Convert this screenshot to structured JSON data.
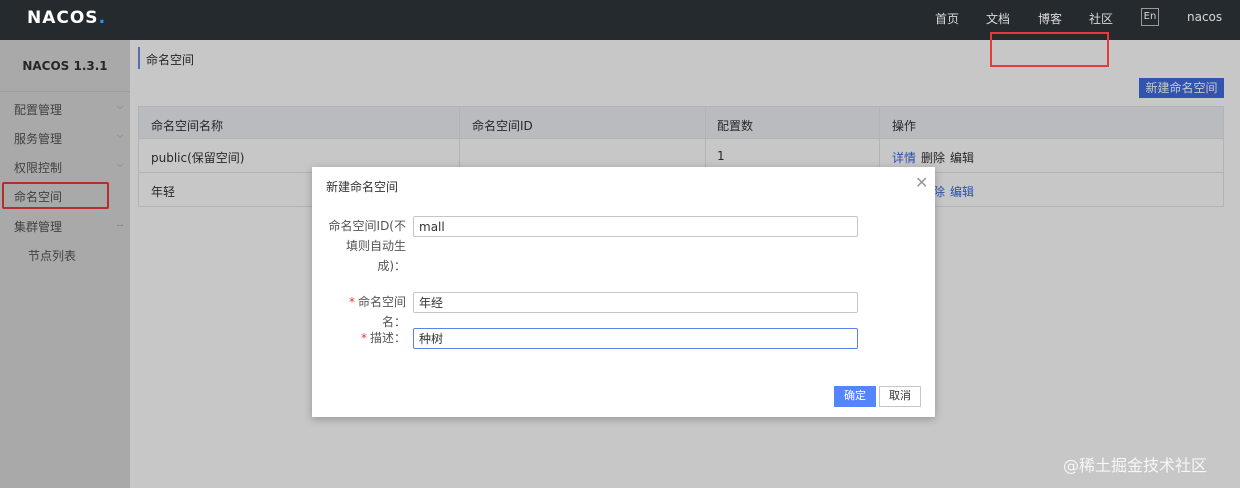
{
  "header": {
    "logo_text": "NACOS",
    "logo_dot": ".",
    "nav": [
      "首页",
      "文档",
      "博客",
      "社区"
    ],
    "lang": "En",
    "user": "nacos"
  },
  "sidebar": {
    "version": "NACOS 1.3.1",
    "items": [
      "配置管理",
      "服务管理",
      "权限控制",
      "命名空间",
      "集群管理"
    ],
    "sub_items": [
      "节点列表"
    ]
  },
  "main": {
    "breadcrumb": "命名空间",
    "new_button": "新建命名空间",
    "table": {
      "headers": [
        "命名空间名称",
        "命名空间ID",
        "配置数",
        "操作"
      ],
      "rows": [
        {
          "name": "public(保留空间)",
          "id": "",
          "count": "1",
          "ops": [
            "详情",
            "删除",
            "编辑"
          ]
        },
        {
          "name": "年轻",
          "id": "",
          "count": "",
          "ops": [
            "除",
            "编辑"
          ]
        }
      ]
    }
  },
  "dialog": {
    "title": "新建命名空间",
    "id_label_lines": [
      "命名空间ID(不",
      "填则自动生",
      "成)："
    ],
    "id_value": "mall",
    "name_label": "命名空间名：",
    "name_value": "年经",
    "desc_label": "描述：",
    "desc_value": "种树",
    "required_mark": "*",
    "ok": "确定",
    "cancel": "取消"
  },
  "watermark": "@稀土掘金技术社区",
  "colors": {
    "topbar": "#252a2f",
    "primary": "#3f6ee0",
    "highlight": "#e83a3a",
    "link": "#3566e6"
  }
}
